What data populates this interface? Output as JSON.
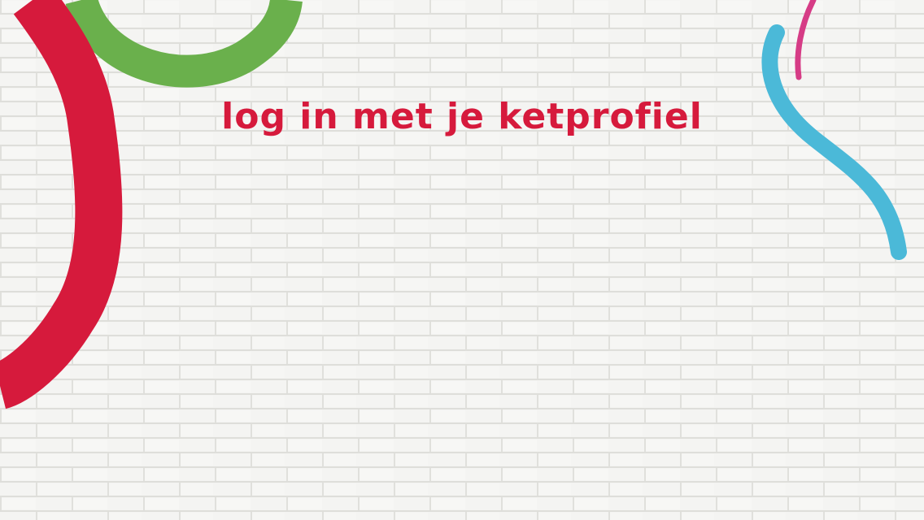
{
  "screen": {
    "title": "log in met je ketprofiel"
  },
  "colors": {
    "wall": "#f3f3f1",
    "mortar": "#dcdcd8",
    "title": "#d61a3c",
    "stroke_red": "#d61a3c",
    "stroke_green": "#6ab04c",
    "stroke_blue": "#4bb9d8",
    "stroke_pink": "#d63c86"
  },
  "decorations": {
    "background": "white-brick-wall",
    "strokes": [
      "red-paint-stroke",
      "green-paint-stroke",
      "blue-paint-stroke",
      "pink-paint-stroke"
    ]
  }
}
